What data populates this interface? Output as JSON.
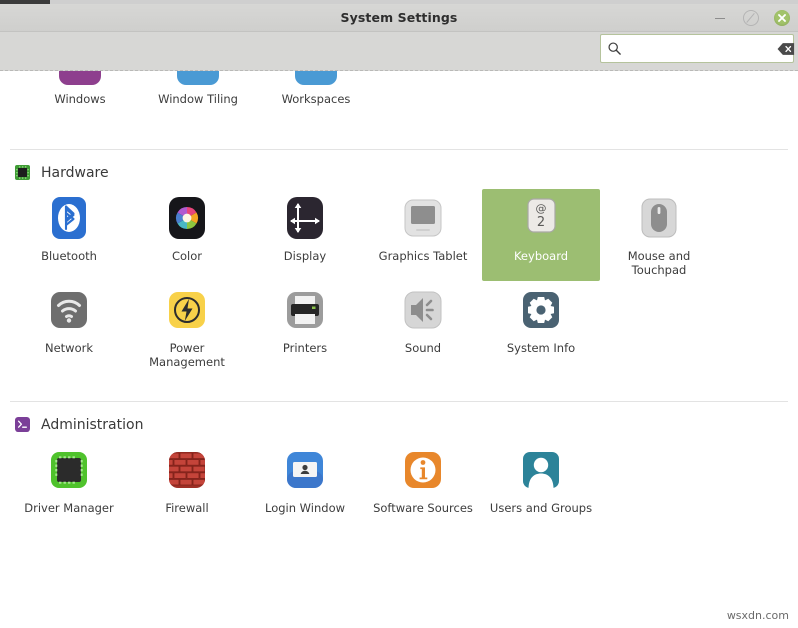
{
  "window": {
    "title": "System Settings",
    "buttons": {
      "minimize": "minimize",
      "maximize": "restore",
      "close": "close"
    }
  },
  "search": {
    "value": "",
    "placeholder": "",
    "icon": "search-icon",
    "clear_icon": "clear-icon"
  },
  "cut_off_row": {
    "items": [
      {
        "label": "Windows",
        "color": "#8e3f8e"
      },
      {
        "label": "Window Tiling",
        "color": "#4a9ad4"
      },
      {
        "label": "Workspaces",
        "color": "#4a9ad4"
      }
    ]
  },
  "sections": [
    {
      "id": "hardware",
      "title": "Hardware",
      "icon": "chip-icon",
      "icon_color": "#3f9c35",
      "items": [
        {
          "label": "Bluetooth",
          "icon": "bluetooth-icon",
          "selected": false
        },
        {
          "label": "Color",
          "icon": "color-icon",
          "selected": false
        },
        {
          "label": "Display",
          "icon": "display-icon",
          "selected": false
        },
        {
          "label": "Graphics Tablet",
          "icon": "graphics-tablet-icon",
          "selected": false
        },
        {
          "label": "Keyboard",
          "icon": "keyboard-icon",
          "selected": true
        },
        {
          "label": "Mouse and Touchpad",
          "icon": "mouse-icon",
          "selected": false
        },
        {
          "label": "Network",
          "icon": "network-icon",
          "selected": false
        },
        {
          "label": "Power Management",
          "icon": "power-icon",
          "selected": false
        },
        {
          "label": "Printers",
          "icon": "printer-icon",
          "selected": false
        },
        {
          "label": "Sound",
          "icon": "sound-icon",
          "selected": false
        },
        {
          "label": "System Info",
          "icon": "system-info-icon",
          "selected": false
        }
      ]
    },
    {
      "id": "administration",
      "title": "Administration",
      "icon": "terminal-icon",
      "icon_color": "#7b3f98",
      "items": [
        {
          "label": "Driver Manager",
          "icon": "driver-manager-icon",
          "selected": false
        },
        {
          "label": "Firewall",
          "icon": "firewall-icon",
          "selected": false
        },
        {
          "label": "Login Window",
          "icon": "login-window-icon",
          "selected": false
        },
        {
          "label": "Software Sources",
          "icon": "software-sources-icon",
          "selected": false
        },
        {
          "label": "Users and Groups",
          "icon": "users-groups-icon",
          "selected": false
        }
      ]
    }
  ],
  "watermark": "wsxdn.com",
  "colors": {
    "selection": "#9cbe72",
    "titlebar": "#d7d7d5",
    "close_button": "#a2c36a",
    "text": "#3c3c3c"
  }
}
